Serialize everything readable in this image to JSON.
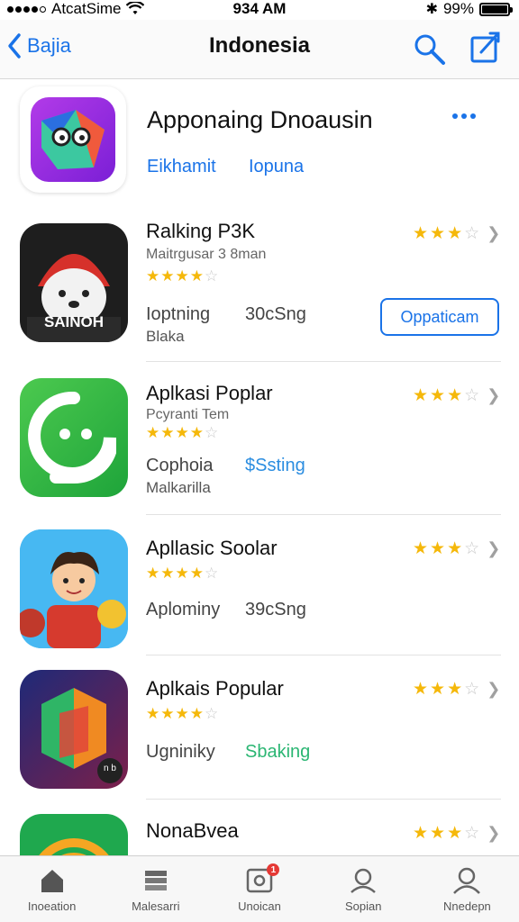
{
  "status_bar": {
    "carrier": "AtcatSime",
    "time": "934 AM",
    "battery": "99%",
    "battery_level": 0.99,
    "signal_bars": 4
  },
  "nav": {
    "back_label": "Bajia",
    "title": "Indonesia",
    "search_icon": "search-icon",
    "compose_icon": "compose-icon"
  },
  "featured": {
    "title": "Apponaing Dnoausin",
    "link1": "Eikhamit",
    "link2": "Iopuna",
    "icon": "app-icon-purple"
  },
  "apps": [
    {
      "name": "Ralking P3K",
      "sub": "Maitrgusar 3 8man",
      "stars": 4,
      "right_stars": 3,
      "meta_a": "Ioptning",
      "meta_b": "30cSng",
      "meta_b_color": "gray",
      "meta_c": "Blaka",
      "button": "Oppaticam",
      "icon_text": "SAINOH"
    },
    {
      "name": "Aplkasi Poplar",
      "sub": "Pcyranti Tem",
      "stars": 4,
      "right_stars": 3,
      "meta_a": "Cophoia",
      "meta_b": "$Ssting",
      "meta_b_color": "blue",
      "meta_c": "Malkarilla"
    },
    {
      "name": "Apllasic Soolar",
      "stars": 4,
      "right_stars": 3,
      "meta_a": "Aplominy",
      "meta_b": "39cSng",
      "meta_b_color": "gray"
    },
    {
      "name": "Aplkais Popular",
      "stars": 4,
      "right_stars": 3,
      "meta_a": "Ugniniky",
      "meta_b": "Sbaking",
      "meta_b_color": "green",
      "icon_text": "n b"
    },
    {
      "name": "NonaBvea",
      "right_stars": 3
    }
  ],
  "tabs": [
    {
      "label": "Inoeation",
      "icon": "home-icon"
    },
    {
      "label": "Malesarri",
      "icon": "stack-icon"
    },
    {
      "label": "Unoican",
      "icon": "updates-icon",
      "badge": "1"
    },
    {
      "label": "Sopian",
      "icon": "search-person-icon"
    },
    {
      "label": "Nnedepn",
      "icon": "account-icon"
    }
  ],
  "colors": {
    "accent": "#1a73e8",
    "star": "#f5b80a"
  }
}
